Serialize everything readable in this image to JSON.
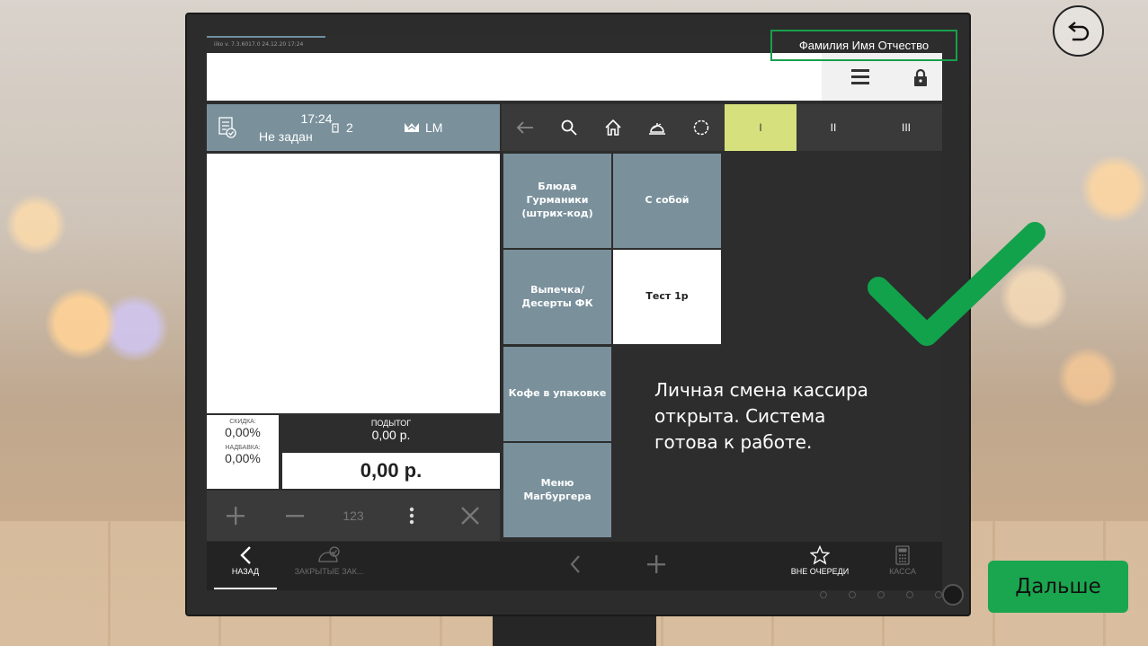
{
  "version": "iiko  v. 7.3.6017.0     24.12.20   17:24",
  "user": "Фамилия Имя Отчество",
  "order": {
    "time": "17:24",
    "status": "Не задан",
    "guests": "2",
    "waiter": "LM"
  },
  "totals": {
    "discount_label": "СКИДКА:",
    "discount_value": "0,00%",
    "surcharge_label": "НАДБАВКА:",
    "surcharge_value": "0,00%",
    "subtotal_label": "ПОДЫТОГ",
    "subtotal_value": "0,00 р.",
    "total_value": "0,00 р."
  },
  "calc": {
    "numpad_label": "123"
  },
  "seats": [
    "I",
    "II",
    "III"
  ],
  "active_seat": "I",
  "categories": [
    {
      "label": "Блюда Гурманики (штрих-код)",
      "style": "gray"
    },
    {
      "label": "С собой",
      "style": "gray"
    },
    {
      "label": "Выпечка/Десерты ФК",
      "style": "gray"
    },
    {
      "label": "Тест 1р",
      "style": "white"
    },
    {
      "label": "Кофе в упаковке",
      "style": "gray"
    },
    {
      "label": "Меню Магбургера",
      "style": "gray"
    }
  ],
  "note": "Личная смена кассира открыта. Система готова к работе.",
  "bottom_nav": {
    "back": "НАЗАД",
    "closed_orders": "ЗАКРЫТЫЕ ЗАК...",
    "out_of_queue": "ВНЕ ОЧЕРЕДИ",
    "cashbox": "КАССА"
  },
  "next_button": "Дальше",
  "colors": {
    "accent_green": "#1aa64f",
    "tile_gray": "#7a919c",
    "active_seat": "#d6e07d"
  }
}
